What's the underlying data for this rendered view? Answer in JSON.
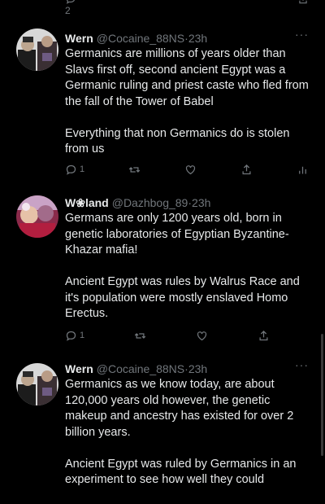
{
  "top_actions": {
    "reply_count": "2"
  },
  "tweets": [
    {
      "name": "Wern",
      "handle": "@Cocaine_88NS",
      "separator": "·",
      "time": "23h",
      "paragraphs": [
        "Germanics are millions of years older than Slavs first off, second ancient Egypt was a Germanic ruling and priest caste who fled from the fall of the Tower of Babel",
        "Everything that non Germanics do is stolen from us"
      ],
      "reply_count": "1"
    },
    {
      "name": "W❀land",
      "handle": "@Dazhbog_89",
      "separator": "·",
      "time": "23h",
      "paragraphs": [
        "Germans are only 1200 years old, born in genetic laboratories of Egyptian Byzantine-Khazar mafia!",
        "Ancient Egypt was rules by Walrus Race and it's population were mostly enslaved Homo Erectus."
      ],
      "reply_count": "1"
    },
    {
      "name": "Wern",
      "handle": "@Cocaine_88NS",
      "separator": "·",
      "time": "23h",
      "paragraphs": [
        "Germanics as we know today, are about 120,000 years old however, the genetic makeup and ancestry has existed for over 2 billion years.",
        "Ancient Egypt was ruled by Germanics in an experiment to see how well they could"
      ],
      "reply_count": ""
    }
  ],
  "more_label": "···",
  "colors": {
    "background": "#000000",
    "text": "#e7e9ea",
    "muted": "#71767b"
  }
}
